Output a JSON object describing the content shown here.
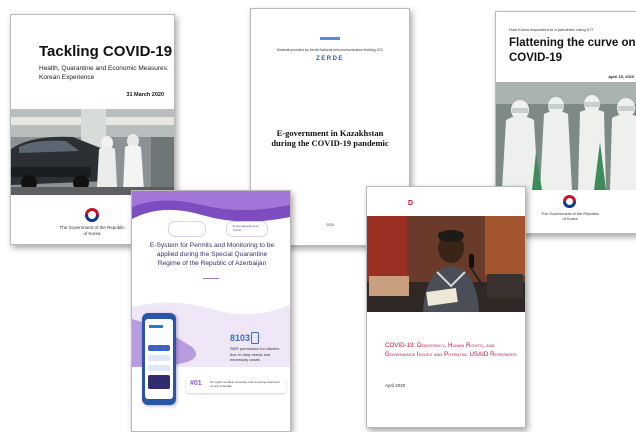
{
  "doc1": {
    "title": "Tackling COVID-19",
    "subtitle": "Health, Quarantine and Economic Measures: Korean Experience",
    "date": "31 March 2020",
    "footer": "The Government of the Republic of Korea"
  },
  "doc2": {
    "logo": "ZERDE",
    "provider": "Material provided by Zerde National Infocommunication Holding JSC",
    "title": "E-government in Kazakhstan during the COVID-19 pandemic",
    "footer": "2020"
  },
  "doc3": {
    "kicker": "How Korea responded to a pandemic using ICT",
    "title": "Flattening the curve on COVID-19",
    "date": "April 15, 2020",
    "footer": "The Government of the Republic of Korea"
  },
  "doc4": {
    "title": "E-System for Permits and Monitoring to be applied during the Special Quarantine Regime of the Republic of Azerbaijan",
    "partner": "E-Gov Development Center",
    "stat_number": "8103",
    "stat_text": "SMS permission for citizens due to daily needs and necessary cases",
    "rank": "#01",
    "rank_text": "for urgent medical necessity and receiving treatment on any schedule"
  },
  "doc5": {
    "logo_fragment": "D",
    "title": "COVID-19: Democracy, Human Rights, and Governance Issues and Potential USAID Responses",
    "date": "April 2020"
  },
  "colors": {
    "doc5_title": "#b4173a",
    "doc4_purple": "#6a3fa6",
    "doc4_blue": "#2a78c8"
  }
}
